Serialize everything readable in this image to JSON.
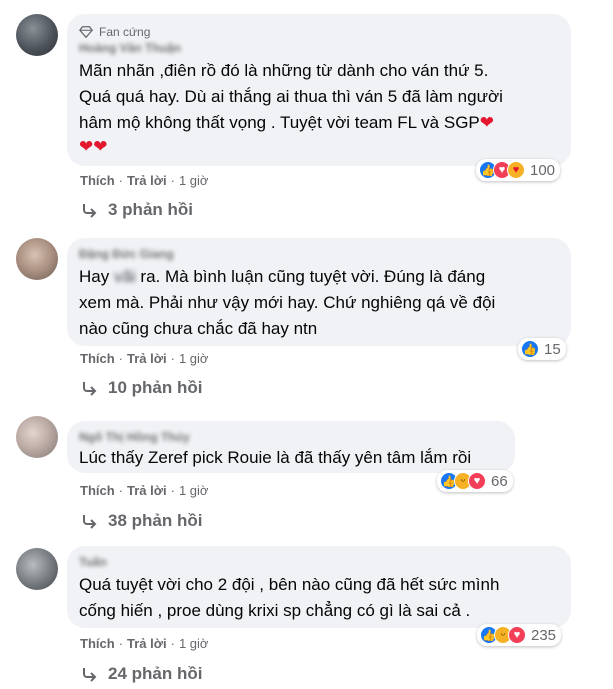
{
  "badge_label": "Fan cứng",
  "comments": [
    {
      "author": "Hoàng Văn Thuận",
      "text": "Mãn nhãn ,điên rồ đó là những từ dành cho ván thứ 5.\nQuá quá hay. Dù ai thắng ai thua thì ván 5 đã làm người\nhâm mộ không thất vọng . Tuyệt vời team FL và SGP",
      "hearts": "❤❤",
      "trailing_heart": "❤",
      "like_label": "Thích",
      "reply_label": "Trả lời",
      "time": "1 giờ",
      "reaction_count": "100",
      "reactions": [
        "like",
        "love",
        "care"
      ],
      "replies_label": "3 phản hồi"
    },
    {
      "author": "Đặng Đức Giang",
      "text_before": "Hay ",
      "text_blurred": "vãi",
      "text_after": " ra. Mà bình luận cũng tuyệt vời. Đúng là đáng\nxem mà. Phải như vậy mới hay. Chứ nghiêng qá về đội\nnào cũng chưa chắc đã hay ntn",
      "like_label": "Thích",
      "reply_label": "Trả lời",
      "time": "1 giờ",
      "reaction_count": "15",
      "reactions": [
        "like"
      ],
      "replies_label": "10 phản hồi"
    },
    {
      "author": "Ngô Thị Hồng Thúy",
      "text": "Lúc thấy Zeref pick Rouie là đã thấy yên tâm lắm rồi",
      "like_label": "Thích",
      "reply_label": "Trả lời",
      "time": "1 giờ",
      "reaction_count": "66",
      "reactions": [
        "like",
        "haha",
        "love"
      ],
      "replies_label": "38 phản hồi"
    },
    {
      "author": "Tuấn",
      "text": "Quá tuyệt vời cho 2 đội , bên nào cũng đã hết sức mình\ncống hiến , proe dùng krixi sp chẳng có gì là sai cả .",
      "like_label": "Thích",
      "reply_label": "Trả lời",
      "time": "1 giờ",
      "reaction_count": "235",
      "reactions": [
        "like",
        "haha",
        "love"
      ],
      "replies_label": "24 phản hồi"
    }
  ]
}
